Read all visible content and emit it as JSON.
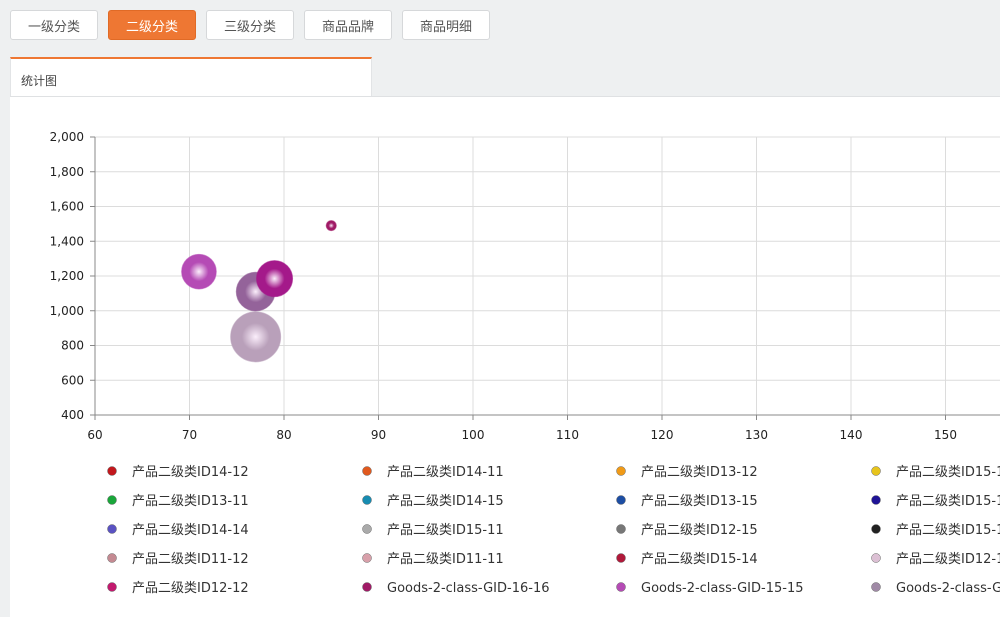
{
  "tabs": [
    {
      "label": "一级分类",
      "active": false
    },
    {
      "label": "二级分类",
      "active": true
    },
    {
      "label": "三级分类",
      "active": false
    },
    {
      "label": "商品品牌",
      "active": false
    },
    {
      "label": "商品明细",
      "active": false
    }
  ],
  "panel": {
    "tab_label": "统计图"
  },
  "chart_data": {
    "type": "scatter",
    "subtype": "bubble",
    "xlim": [
      60,
      160
    ],
    "ylim": [
      400,
      2000
    ],
    "x_ticks": [
      60,
      70,
      80,
      90,
      100,
      110,
      120,
      130,
      140,
      150
    ],
    "y_ticks": [
      400,
      600,
      800,
      1000,
      1200,
      1400,
      1600,
      1800,
      2000
    ],
    "x_tick_labels": [
      "60",
      "70",
      "80",
      "90",
      "100",
      "110",
      "120",
      "130",
      "140",
      "150"
    ],
    "y_tick_labels": [
      "400",
      "600",
      "800",
      "1,000",
      "1,200",
      "1,400",
      "1,600",
      "1,800",
      "2,000"
    ],
    "grid": true,
    "legend_position": "bottom",
    "points": [
      {
        "series": "Goods-2-class-GID-16-16",
        "x": 85,
        "y": 1490,
        "size": 1,
        "color": "#a01a66"
      },
      {
        "series": "Goods-2-class-GID-15-15",
        "x": 71,
        "y": 1225,
        "size": 12,
        "color": "#b54bb5"
      },
      {
        "series": "产品二级类ID12-12",
        "x": 79,
        "y": 1185,
        "size": 13,
        "color": "#a4198a"
      },
      {
        "series": "Goods-2-class-G",
        "x": 77,
        "y": 1110,
        "size": 15,
        "color": "#94639a"
      },
      {
        "series": "产品二级类ID12-1",
        "x": 77,
        "y": 850,
        "size": 25,
        "color": "#b9a0ba"
      }
    ],
    "legend": [
      {
        "name": "产品二级类ID14-12",
        "color": "#c2181d"
      },
      {
        "name": "产品二级类ID14-11",
        "color": "#e0591e"
      },
      {
        "name": "产品二级类ID13-12",
        "color": "#f09a17"
      },
      {
        "name": "产品二级类ID15-1",
        "color": "#e7c41c"
      },
      {
        "name": "产品二级类ID13-11",
        "color": "#1aa63a"
      },
      {
        "name": "产品二级类ID14-15",
        "color": "#178cb1"
      },
      {
        "name": "产品二级类ID13-15",
        "color": "#1d4ea3"
      },
      {
        "name": "产品二级类ID15-1",
        "color": "#1f1496"
      },
      {
        "name": "产品二级类ID14-14",
        "color": "#5a52c2"
      },
      {
        "name": "产品二级类ID15-11",
        "color": "#aaaaaa"
      },
      {
        "name": "产品二级类ID12-15",
        "color": "#777777"
      },
      {
        "name": "产品二级类ID15-1",
        "color": "#222222"
      },
      {
        "name": "产品二级类ID11-12",
        "color": "#c48a92"
      },
      {
        "name": "产品二级类ID11-11",
        "color": "#d8a0aa"
      },
      {
        "name": "产品二级类ID15-14",
        "color": "#b0193a"
      },
      {
        "name": "产品二级类ID12-1",
        "color": "#dcc0d4"
      },
      {
        "name": "产品二级类ID12-12",
        "color": "#c2196e"
      },
      {
        "name": "Goods-2-class-GID-16-16",
        "color": "#a01a66"
      },
      {
        "name": "Goods-2-class-GID-15-15",
        "color": "#b54bb5"
      },
      {
        "name": "Goods-2-class-G",
        "color": "#a08aa6"
      }
    ]
  }
}
